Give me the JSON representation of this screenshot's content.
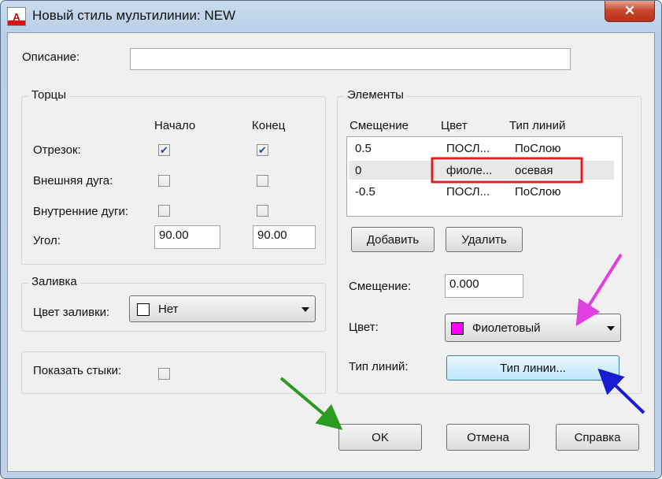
{
  "window": {
    "title": "Новый стиль мультилинии: NEW",
    "close": "✕"
  },
  "description": {
    "label": "Описание:",
    "value": ""
  },
  "caps": {
    "group": "Торцы",
    "col_start": "Начало",
    "col_end": "Конец",
    "line": {
      "label": "Отрезок:",
      "start": true,
      "end": true
    },
    "outer_arc": {
      "label": "Внешняя дуга:",
      "start": false,
      "end": false
    },
    "inner_arcs": {
      "label": "Внутренние дуги:",
      "start": false,
      "end": false
    },
    "angle": {
      "label": "Угол:",
      "start": "90.00",
      "end": "90.00"
    }
  },
  "fill": {
    "group": "Заливка",
    "label": "Цвет заливки:",
    "value": "Нет",
    "swatch": "#ffffff"
  },
  "joints": {
    "label": "Показать стыки:",
    "checked": false
  },
  "elements": {
    "group": "Элементы",
    "headers": {
      "offset": "Смещение",
      "color": "Цвет",
      "linetype": "Тип линий"
    },
    "rows": [
      {
        "offset": "0.5",
        "color": "ПОСЛ...",
        "linetype": "ПоСлою"
      },
      {
        "offset": "0",
        "color": "фиоле...",
        "linetype": "осевая"
      },
      {
        "offset": "-0.5",
        "color": "ПОСЛ...",
        "linetype": "ПоСлою"
      }
    ],
    "add": "Добавить",
    "remove": "Удалить",
    "offset_label": "Смещение:",
    "offset_value": "0.000",
    "color_label": "Цвет:",
    "color_value": "Фиолетовый",
    "color_swatch": "#ff00ff",
    "linetype_label": "Тип линий:",
    "linetype_button": "Тип линии..."
  },
  "buttons": {
    "ok": "OK",
    "cancel": "Отмена",
    "help": "Справка"
  },
  "annotation_colors": {
    "highlight": "#e02020",
    "magenta_arrow": "#e040e0",
    "blue_arrow": "#1a1ad0",
    "green_arrow": "#2a9a20"
  }
}
